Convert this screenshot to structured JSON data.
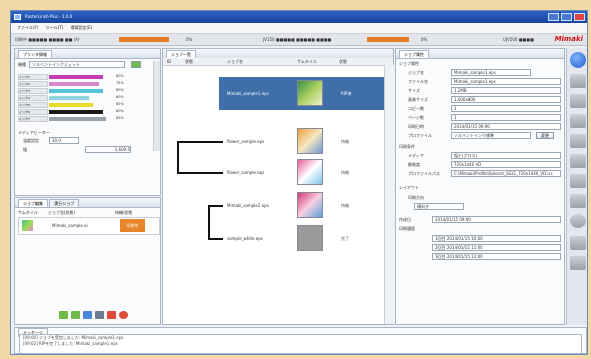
{
  "window": {
    "title": "RasterLink6 Plus - 1.0.0"
  },
  "menu": [
    "ファイル(F)",
    "ツール(T)",
    "環境設定(E)"
  ],
  "status": {
    "seg1": "印刷中 ■■■■■ ■■■■ ■■ (A)",
    "seg2": "0%",
    "seg3": "JV150 ■■■■■ ■■■■■ ■■■■",
    "seg4": "0%",
    "seg5": "UJV500 ■■■■",
    "brand": "Mimaki"
  },
  "left": {
    "header": "プリンタ情報",
    "printer_label": "機種",
    "printer_value": "ソルベントインクジェット",
    "inks": [
      {
        "name": "インク1",
        "color": "#c43fb0",
        "pct": "80%"
      },
      {
        "name": "インク2",
        "color": "#d48acb",
        "pct": "75%"
      },
      {
        "name": "インク3",
        "color": "#54c3d6",
        "pct": "80%"
      },
      {
        "name": "インク4",
        "color": "#8fd6e3",
        "pct": "60%"
      },
      {
        "name": "インク5",
        "color": "#e6dc2e",
        "pct": "65%"
      },
      {
        "name": "インク6",
        "color": "#1a1a1a",
        "pct": "80%"
      },
      {
        "name": "インク7",
        "color": "#9aa0a8",
        "pct": "85%"
      }
    ],
    "media_header": "メディアヒーター",
    "temp_label": "温度設定",
    "temp_value": "30.0",
    "width_label": "幅",
    "width_value": "1,600.0",
    "tabs": [
      "ジョブ編集",
      "実行ジョブ"
    ],
    "job_cols": [
      "サムネイル",
      "ジョブ名(状態)",
      "待機/状態"
    ],
    "job_name": "Mimaki_sample.ai",
    "job_status": "印刷中"
  },
  "middle": {
    "header": "ジョブ一覧",
    "cols": [
      "ID",
      "状態",
      "ジョブ名",
      "サムネイル",
      "状態"
    ],
    "jobs": [
      {
        "name": "Mimaki_sample1.eps",
        "status": "RIP済"
      },
      {
        "name": "flower_sample.eps",
        "status": "待機"
      },
      {
        "name": "flower_sample.eps",
        "status": "待機"
      },
      {
        "name": "Mimaki_sample2.eps",
        "status": "待機"
      },
      {
        "name": "sample_white.eps",
        "status": "完了"
      }
    ]
  },
  "right": {
    "header": "ジョブ属性",
    "section1": "ジョブ属性",
    "fields": [
      {
        "label": "ジョブ名",
        "value": "Mimaki_sample1.eps"
      },
      {
        "label": "ファイル名",
        "value": "Mimaki_sample1.eps"
      },
      {
        "label": "サイズ",
        "value": "1.2MB"
      },
      {
        "label": "画像サイズ",
        "value": "1,000x800"
      },
      {
        "label": "コピー数",
        "value": "1"
      },
      {
        "label": "ページ数",
        "value": "1"
      },
      {
        "label": "印刷日時",
        "value": "2014/01/15 09:00"
      }
    ],
    "profile_label": "プロファイル",
    "profile_value": "ソルベントインク標準",
    "profile_btn": "変更",
    "section2": "印刷条件",
    "media_label": "メディア",
    "media_value": "塩ビ(グロス)",
    "res_label": "解像度",
    "res_value": "720x1440 VD",
    "path_label": "プロファイルパス",
    "path_value": "C:\\Mimaki\\Profile\\Solvent_SS21_720x1440_VD.icc",
    "section3": "レイアウト",
    "layout_label": "印刷方向",
    "layout_value": "横向き",
    "date_label": "作成日",
    "date_value": "2014/01/15 09:00",
    "history_label": "印刷履歴",
    "history": [
      "1回目 2014/01/15 10:00",
      "2回目 2014/01/15 11:00",
      "3回目 2014/01/15 12:00"
    ]
  },
  "log": {
    "tab": "メッセージ",
    "lines": [
      "[09:00] ジョブを受信しました: Mimaki_sample1.eps",
      "[09:02] RIPを完了しました: Mimaki_sample1.eps"
    ]
  }
}
